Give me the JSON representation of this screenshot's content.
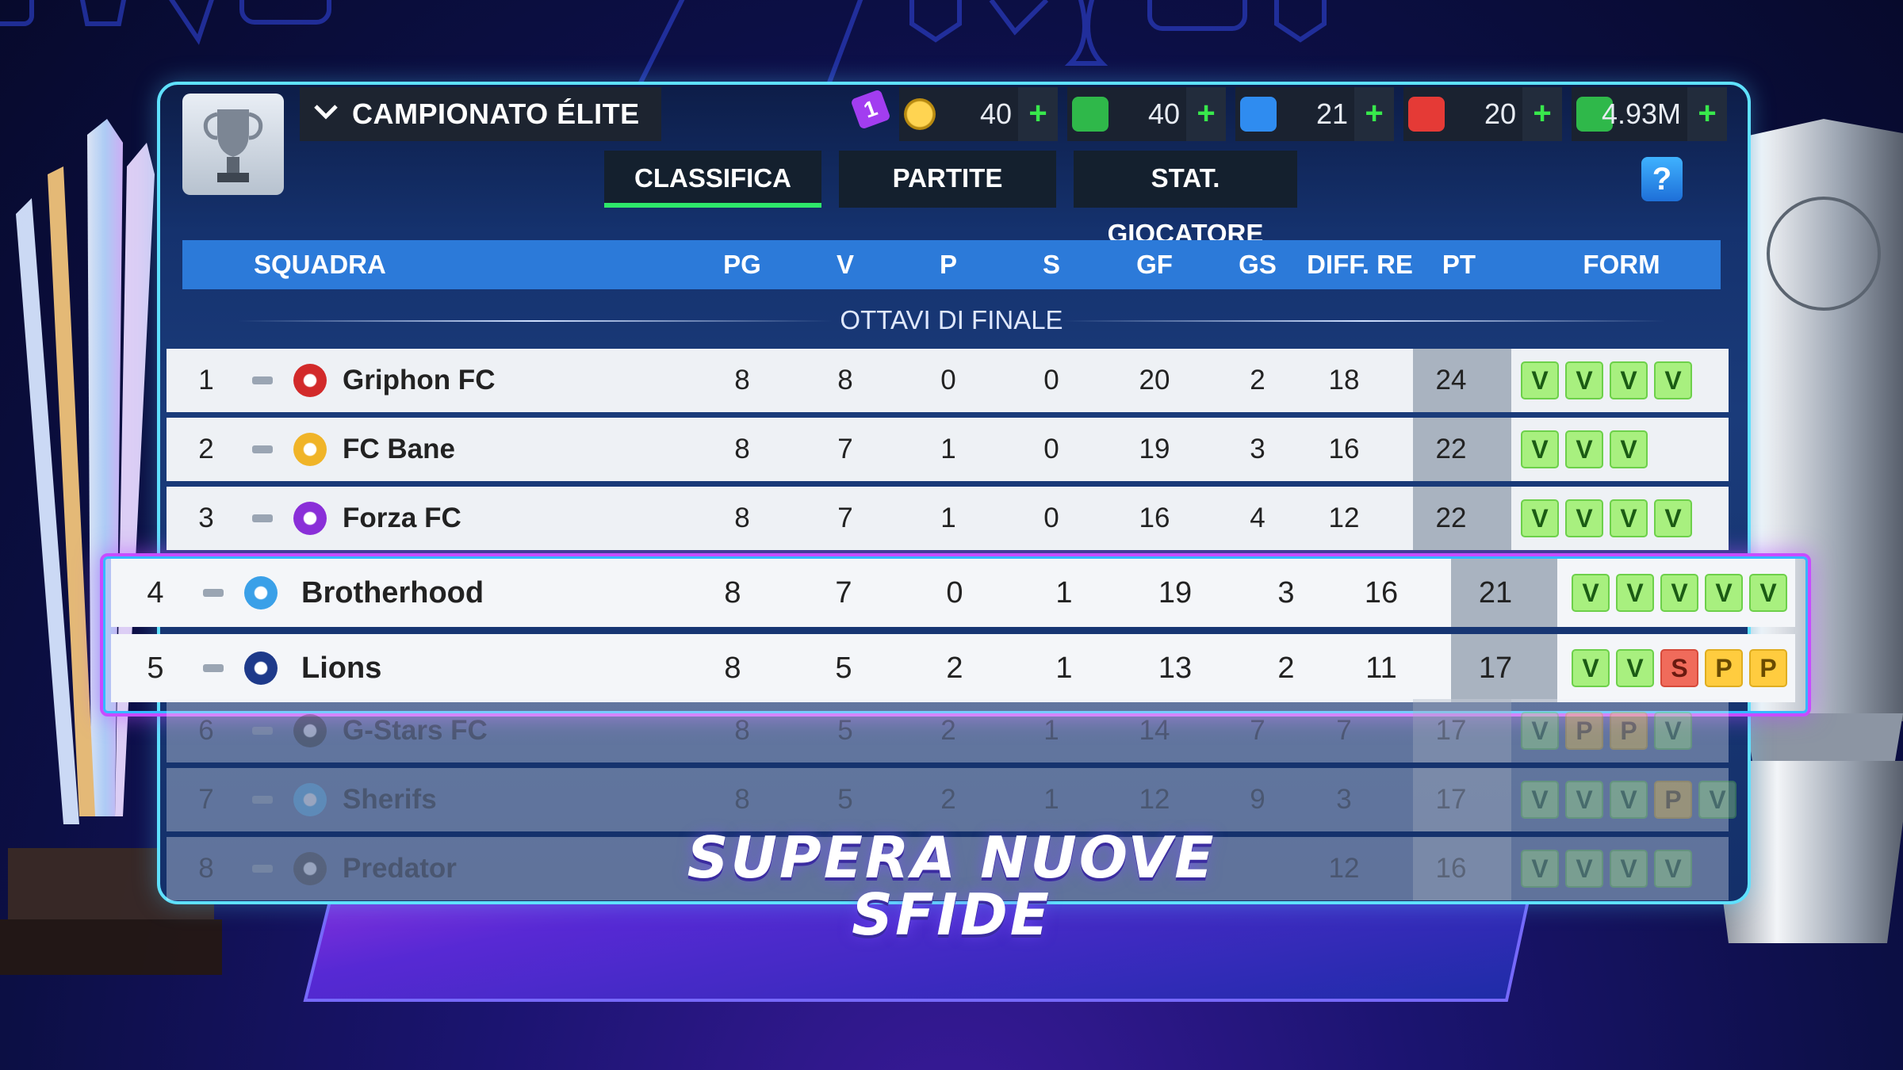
{
  "header": {
    "title": "CAMPIONATO ÉLITE",
    "resources": [
      {
        "name": "tokens",
        "icon": "token-icon",
        "badge": "1",
        "value": "40"
      },
      {
        "name": "rests",
        "icon": "rest-icon",
        "value": "40"
      },
      {
        "name": "boosters",
        "icon": "booster-icon",
        "value": "21"
      },
      {
        "name": "medicine",
        "icon": "medical-icon",
        "value": "20"
      },
      {
        "name": "money",
        "icon": "money-icon",
        "value": "4.93M"
      }
    ],
    "plus": "+"
  },
  "tabs": [
    {
      "label": "CLASSIFICA",
      "active": true
    },
    {
      "label": "PARTITE",
      "active": false
    },
    {
      "label": "STAT. GIOCATORE",
      "active": false
    }
  ],
  "help": "?",
  "table": {
    "columns": [
      "SQUADRA",
      "PG",
      "V",
      "P",
      "S",
      "GF",
      "GS",
      "DIFF. RE",
      "PT",
      "FORM"
    ],
    "section": "OTTAVI DI FINALE",
    "rows": [
      {
        "pos": "1",
        "team": "Griphon FC",
        "pg": "8",
        "v": "8",
        "p": "0",
        "s": "0",
        "gf": "20",
        "gs": "2",
        "diff": "18",
        "pt": "24",
        "form": [
          "V",
          "V",
          "V",
          "V"
        ]
      },
      {
        "pos": "2",
        "team": "FC Bane",
        "pg": "8",
        "v": "7",
        "p": "1",
        "s": "0",
        "gf": "19",
        "gs": "3",
        "diff": "16",
        "pt": "22",
        "form": [
          "V",
          "V",
          "V"
        ]
      },
      {
        "pos": "3",
        "team": "Forza FC",
        "pg": "8",
        "v": "7",
        "p": "1",
        "s": "0",
        "gf": "16",
        "gs": "4",
        "diff": "12",
        "pt": "22",
        "form": [
          "V",
          "V",
          "V",
          "V"
        ]
      },
      {
        "pos": "4",
        "team": "Brotherhood",
        "pg": "8",
        "v": "7",
        "p": "0",
        "s": "1",
        "gf": "19",
        "gs": "3",
        "diff": "16",
        "pt": "21",
        "form": [
          "V",
          "V",
          "V",
          "V",
          "V"
        ]
      },
      {
        "pos": "5",
        "team": "Lions",
        "pg": "8",
        "v": "5",
        "p": "2",
        "s": "1",
        "gf": "13",
        "gs": "2",
        "diff": "11",
        "pt": "17",
        "form": [
          "V",
          "V",
          "S",
          "P",
          "P"
        ]
      },
      {
        "pos": "6",
        "team": "G-Stars FC",
        "pg": "8",
        "v": "5",
        "p": "2",
        "s": "1",
        "gf": "14",
        "gs": "7",
        "diff": "7",
        "pt": "17",
        "form": [
          "V",
          "P",
          "P",
          "V"
        ]
      },
      {
        "pos": "7",
        "team": "Sherifs",
        "pg": "8",
        "v": "5",
        "p": "2",
        "s": "1",
        "gf": "12",
        "gs": "9",
        "diff": "3",
        "pt": "17",
        "form": [
          "V",
          "V",
          "V",
          "P",
          "V"
        ]
      },
      {
        "pos": "8",
        "team": "Predator",
        "pg": "",
        "v": "",
        "p": "",
        "s": "",
        "gf": "",
        "gs": "",
        "diff": "12",
        "pt": "16",
        "form": [
          "V",
          "V",
          "V",
          "V"
        ]
      }
    ]
  },
  "banner": {
    "line1": "SUPERA NUOVE",
    "line2": "SFIDE"
  },
  "colors": {
    "accent": "#2c7ad9",
    "highlight_border": "#c74cff",
    "panel_border": "#5fe1ff",
    "active_tab": "#2ee86a"
  }
}
